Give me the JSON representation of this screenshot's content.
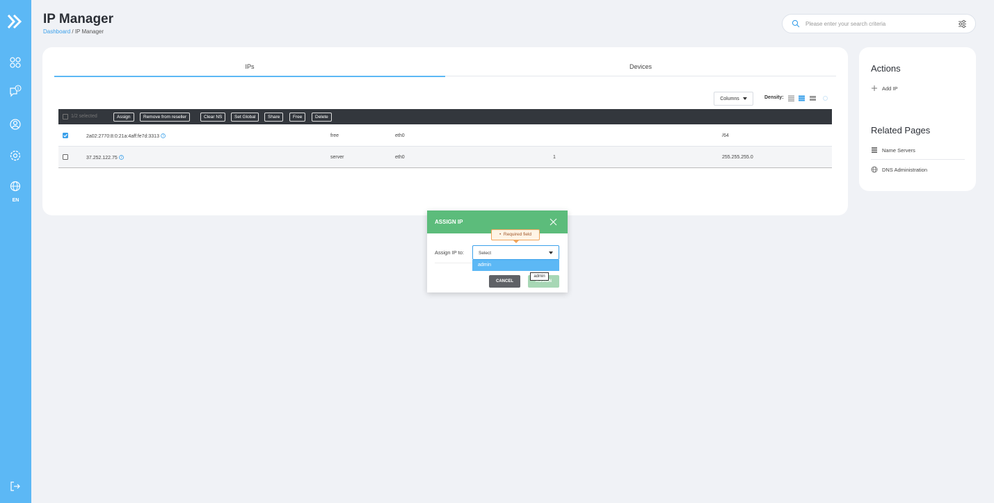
{
  "sidebar": {
    "language": "EN",
    "icons": [
      "logo-icon",
      "apps-icon",
      "chat-icon",
      "user-icon",
      "gear-icon",
      "globe-icon",
      "logout-icon"
    ],
    "accent": "#5cb8f5"
  },
  "header": {
    "title": "IP Manager",
    "breadcrumb": {
      "link": "Dashboard",
      "separator": " / ",
      "current": "IP Manager"
    }
  },
  "search": {
    "placeholder": "Please enter your search criteria"
  },
  "tabs": [
    {
      "label": "IPs",
      "active": true
    },
    {
      "label": "Devices",
      "active": false
    }
  ],
  "table_controls": {
    "columns_label": "Columns",
    "density_label": "Density:"
  },
  "toolbar": {
    "selection_text": "1/2 selected",
    "buttons": [
      "Assign",
      "Remove from reseller",
      "Clear NS",
      "Set Global",
      "Share",
      "Free",
      "Delete"
    ]
  },
  "rows": [
    {
      "checked": true,
      "ip": "2a02:2770:8:0:21a:4aff:fe7d:3313",
      "status": "free",
      "interface": "eth0",
      "count": "",
      "netmask": "/64"
    },
    {
      "checked": false,
      "ip": "37.252.122.75",
      "status": "server",
      "interface": "eth0",
      "count": "1",
      "netmask": "255.255.255.0"
    }
  ],
  "side_panel": {
    "actions_title": "Actions",
    "add_ip_label": "Add IP",
    "related_title": "Related Pages",
    "related": [
      "Name Servers",
      "DNS Administration"
    ]
  },
  "modal": {
    "title": "ASSIGN IP",
    "label": "Assign IP to:",
    "select_value": "Select",
    "option": "admin",
    "required_tip": "Required field",
    "hover_tip": "admin",
    "cancel_label": "CANCEL",
    "assign_label": "ASSIGN",
    "header_color": "#5cbc7b"
  }
}
